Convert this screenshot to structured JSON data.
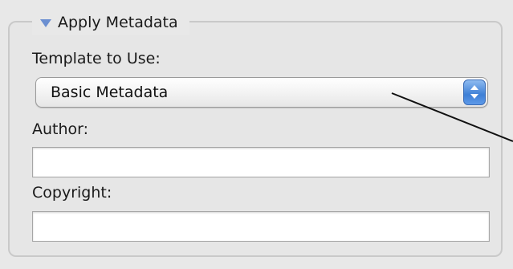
{
  "panel": {
    "title": "Apply Metadata",
    "disclosure_icon": "disclosure-triangle-down-icon"
  },
  "template": {
    "label": "Template to Use:",
    "selected": "Basic Metadata",
    "arrows_icon": "popup-stepper-arrows-icon"
  },
  "author": {
    "label": "Author:",
    "value": ""
  },
  "copyright": {
    "label": "Copyright:",
    "value": ""
  },
  "colors": {
    "accent": "#3e7fd6",
    "disclosure": "#6b8fd1"
  }
}
